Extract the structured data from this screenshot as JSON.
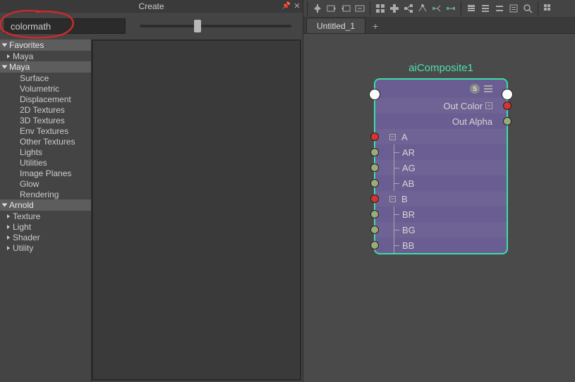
{
  "panel": {
    "title": "Create",
    "search_value": "colormath"
  },
  "tree": {
    "favorites": {
      "label": "Favorites",
      "items": [
        {
          "label": "Maya",
          "has_children": true
        }
      ]
    },
    "maya": {
      "label": "Maya",
      "items": [
        {
          "label": "Surface"
        },
        {
          "label": "Volumetric"
        },
        {
          "label": "Displacement"
        },
        {
          "label": "2D Textures"
        },
        {
          "label": "3D Textures"
        },
        {
          "label": "Env Textures"
        },
        {
          "label": "Other Textures"
        },
        {
          "label": "Lights"
        },
        {
          "label": "Utilities"
        },
        {
          "label": "Image Planes"
        },
        {
          "label": "Glow"
        },
        {
          "label": "Rendering"
        }
      ]
    },
    "arnold": {
      "label": "Arnold",
      "items": [
        {
          "label": "Texture",
          "has_children": true
        },
        {
          "label": "Light",
          "has_children": true
        },
        {
          "label": "Shader",
          "has_children": true
        },
        {
          "label": "Utility",
          "has_children": true
        }
      ]
    }
  },
  "tabs": {
    "active": "Untitled_1"
  },
  "node": {
    "title": "aiComposite1",
    "outputs": [
      {
        "label": "Out Color",
        "expandable": true,
        "port_color": "red"
      },
      {
        "label": "Out Alpha",
        "port_color": "green"
      }
    ],
    "inputs": [
      {
        "label": "A",
        "port_color": "red",
        "children": [
          {
            "label": "AR",
            "port_color": "green"
          },
          {
            "label": "AG",
            "port_color": "green"
          },
          {
            "label": "AB",
            "port_color": "green"
          }
        ]
      },
      {
        "label": "B",
        "port_color": "red",
        "children": [
          {
            "label": "BR",
            "port_color": "green"
          },
          {
            "label": "BG",
            "port_color": "green"
          },
          {
            "label": "BB",
            "port_color": "green"
          }
        ]
      }
    ]
  }
}
